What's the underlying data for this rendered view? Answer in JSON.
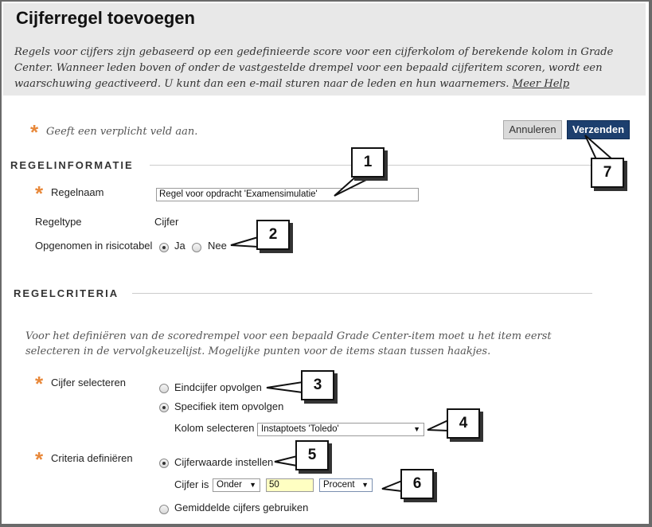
{
  "page": {
    "title": "Cijferregel toevoegen",
    "intro": "Regels voor cijfers zijn gebaseerd op een gedefinieerde score voor een cijferkolom of berekende kolom in Grade Center. Wanneer leden boven of onder de vastgestelde drempel voor een bepaald cijferitem scoren, wordt een waarschuwing geactiveerd. U kunt dan een e-mail sturen naar de leden en hun waarnemers.",
    "help_link": "Meer Help",
    "required_note": "Geeft een verplicht veld aan.",
    "required_star": "*"
  },
  "buttons": {
    "cancel": "Annuleren",
    "submit": "Verzenden"
  },
  "regelinformatie": {
    "title": "REGELINFORMATIE",
    "name_label": "Regelnaam",
    "name_value": "Regel voor opdracht 'Examensimulatie'",
    "type_label": "Regeltype",
    "type_value": "Cijfer",
    "risk_label": "Opgenomen in risicotabel",
    "risk_yes": "Ja",
    "risk_no": "Nee"
  },
  "regelcriteria": {
    "title": "REGELCRITERIA",
    "description": "Voor het definiëren van de scoredrempel voor een bepaald Grade Center-item moet u het item eerst selecteren in de vervolgkeuzelijst. Mogelijke punten voor de items staan tussen haakjes.",
    "select_label": "Cijfer selecteren",
    "option_final": "Eindcijfer opvolgen",
    "option_specific": "Specifiek item opvolgen",
    "column_label": "Kolom selecteren",
    "column_value": "Instaptoets 'Toledo'",
    "criteria_label": "Criteria definiëren",
    "option_grade_value": "Cijferwaarde instellen",
    "grade_is_label": "Cijfer is",
    "operator_value": "Onder",
    "threshold_value": "50",
    "unit_value": "Procent",
    "option_average": "Gemiddelde cijfers gebruiken"
  },
  "callouts": [
    "1",
    "2",
    "3",
    "4",
    "5",
    "6",
    "7"
  ]
}
